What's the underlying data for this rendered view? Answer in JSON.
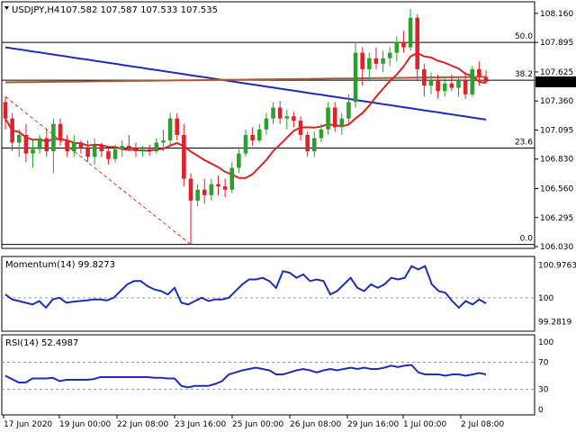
{
  "header": {
    "symbol_tf": "USDJPY,H4",
    "quotes": "107.582 107.587 107.533 107.535"
  },
  "price_panel": {
    "y_ticks": [
      "108.160",
      "107.895",
      "107.625",
      "107.360",
      "107.095",
      "106.830",
      "106.560",
      "106.295",
      "106.030"
    ],
    "current_price": "107.535",
    "fib_labels": [
      "50.0",
      "38.2",
      "23.6",
      "0.0"
    ]
  },
  "momentum_panel": {
    "title": "Momentum(14) 99.8273",
    "y_ticks": [
      "100.9763",
      "100",
      "99.2819"
    ]
  },
  "rsi_panel": {
    "title": "RSI(14) 52.4987",
    "y_ticks": [
      "100",
      "70",
      "30",
      "0"
    ]
  },
  "x_axis": {
    "labels": [
      "17 Jun 2020",
      "19 Jun 00:00",
      "22 Jun 08:00",
      "23 Jun 16:00",
      "25 Jun 00:00",
      "26 Jun 08:00",
      "29 Jun 16:00",
      "1 Jul 00:00",
      "2 Jul 08:00"
    ]
  },
  "colors": {
    "bull": "#2ca02c",
    "bear": "#e0202a",
    "sma_fast": "#dd2222",
    "sma_mid": "#1f2fb4",
    "sma_slow": "#a85a3a",
    "fib": "#e03030",
    "oscillator": "#1f2fb4"
  },
  "chart_data": [
    {
      "type": "candlestick",
      "title": "USDJPY,H4",
      "ylim": [
        106.03,
        108.2
      ],
      "x": [
        "17 Jun 2020",
        "19 Jun 00:00",
        "22 Jun 08:00",
        "23 Jun 16:00",
        "25 Jun 00:00",
        "26 Jun 08:00",
        "29 Jun 16:00",
        "1 Jul 00:00",
        "2 Jul 08:00"
      ],
      "ohlc": [
        [
          107.35,
          107.4,
          107.1,
          107.2
        ],
        [
          107.2,
          107.25,
          106.9,
          106.98
        ],
        [
          106.98,
          107.1,
          106.85,
          107.05
        ],
        [
          107.05,
          107.15,
          106.8,
          106.88
        ],
        [
          106.88,
          107.0,
          106.75,
          106.92
        ],
        [
          106.92,
          107.05,
          106.88,
          107.02
        ],
        [
          107.02,
          107.1,
          106.85,
          106.9
        ],
        [
          106.9,
          107.2,
          106.7,
          107.15
        ],
        [
          107.15,
          107.2,
          106.95,
          107.0
        ],
        [
          107.0,
          107.05,
          106.85,
          106.9
        ],
        [
          106.9,
          107.05,
          106.85,
          106.98
        ],
        [
          106.98,
          107.0,
          106.88,
          106.93
        ],
        [
          106.93,
          107.0,
          106.8,
          106.85
        ],
        [
          106.85,
          107.02,
          106.78,
          106.95
        ],
        [
          106.95,
          106.98,
          106.85,
          106.9
        ],
        [
          106.9,
          106.95,
          106.78,
          106.83
        ],
        [
          106.83,
          106.96,
          106.8,
          106.92
        ],
        [
          106.92,
          107.0,
          106.85,
          106.95
        ],
        [
          106.95,
          107.05,
          106.9,
          106.93
        ],
        [
          106.93,
          106.98,
          106.85,
          106.9
        ],
        [
          106.9,
          106.95,
          106.85,
          106.92
        ],
        [
          106.92,
          106.96,
          106.86,
          106.9
        ],
        [
          106.9,
          107.02,
          106.88,
          106.98
        ],
        [
          106.98,
          107.1,
          106.9,
          107.0
        ],
        [
          107.0,
          107.25,
          106.95,
          107.2
        ],
        [
          107.2,
          107.25,
          107.0,
          107.05
        ],
        [
          107.05,
          107.15,
          106.58,
          106.65
        ],
        [
          106.65,
          106.7,
          106.05,
          106.45
        ],
        [
          106.45,
          106.6,
          106.4,
          106.55
        ],
        [
          106.55,
          106.65,
          106.42,
          106.5
        ],
        [
          106.5,
          106.65,
          106.45,
          106.6
        ],
        [
          106.6,
          106.68,
          106.5,
          106.58
        ],
        [
          106.58,
          106.65,
          106.48,
          106.55
        ],
        [
          106.55,
          106.8,
          106.52,
          106.75
        ],
        [
          106.75,
          106.92,
          106.7,
          106.88
        ],
        [
          106.88,
          107.1,
          106.85,
          107.05
        ],
        [
          107.05,
          107.12,
          106.95,
          107.0
        ],
        [
          107.0,
          107.15,
          106.98,
          107.1
        ],
        [
          107.1,
          107.25,
          107.05,
          107.2
        ],
        [
          107.2,
          107.35,
          107.15,
          107.3
        ],
        [
          107.3,
          107.36,
          107.15,
          107.2
        ],
        [
          107.2,
          107.28,
          107.1,
          107.22
        ],
        [
          107.22,
          107.26,
          107.12,
          107.18
        ],
        [
          107.18,
          107.22,
          107.0,
          107.05
        ],
        [
          107.05,
          107.08,
          106.85,
          106.9
        ],
        [
          106.9,
          107.08,
          106.85,
          107.02
        ],
        [
          107.02,
          107.15,
          106.98,
          107.1
        ],
        [
          107.1,
          107.35,
          107.05,
          107.3
        ],
        [
          107.3,
          107.35,
          107.08,
          107.12
        ],
        [
          107.12,
          107.25,
          107.05,
          107.2
        ],
        [
          107.2,
          107.42,
          107.15,
          107.35
        ],
        [
          107.35,
          107.9,
          107.3,
          107.8
        ],
        [
          107.8,
          107.85,
          107.5,
          107.65
        ],
        [
          107.65,
          107.8,
          107.55,
          107.75
        ],
        [
          107.75,
          107.85,
          107.65,
          107.7
        ],
        [
          107.7,
          107.82,
          107.62,
          107.75
        ],
        [
          107.75,
          107.85,
          107.68,
          107.8
        ],
        [
          107.8,
          107.95,
          107.72,
          107.9
        ],
        [
          107.9,
          108.0,
          107.8,
          107.85
        ],
        [
          107.85,
          108.2,
          107.82,
          108.12
        ],
        [
          108.12,
          108.15,
          107.55,
          107.65
        ],
        [
          107.65,
          107.7,
          107.4,
          107.5
        ],
        [
          107.5,
          107.62,
          107.42,
          107.55
        ],
        [
          107.55,
          107.6,
          107.38,
          107.45
        ],
        [
          107.45,
          107.58,
          107.4,
          107.52
        ],
        [
          107.52,
          107.6,
          107.45,
          107.48
        ],
        [
          107.48,
          107.58,
          107.4,
          107.55
        ],
        [
          107.55,
          107.62,
          107.38,
          107.42
        ],
        [
          107.42,
          107.68,
          107.4,
          107.65
        ],
        [
          107.65,
          107.72,
          107.5,
          107.58
        ],
        [
          107.58,
          107.64,
          107.52,
          107.535
        ]
      ]
    },
    {
      "type": "line",
      "title": "Momentum(14) 99.8273",
      "ylim": [
        99.05,
        101.05
      ],
      "series": [
        {
          "values": [
            100.1,
            99.95,
            99.9,
            99.85,
            99.8,
            99.9,
            99.7,
            99.95,
            100.0,
            99.85,
            99.88,
            99.9,
            99.92,
            99.95,
            99.95,
            99.92,
            100.0,
            100.2,
            100.4,
            100.5,
            100.5,
            100.35,
            100.25,
            100.2,
            100.1,
            100.3,
            99.85,
            99.8,
            99.9,
            100.0,
            99.9,
            99.95,
            99.95,
            100.0,
            100.2,
            100.4,
            100.55,
            100.55,
            100.6,
            100.5,
            100.3,
            100.8,
            100.75,
            100.6,
            100.7,
            100.5,
            100.55,
            100.5,
            100.1,
            100.2,
            100.4,
            100.6,
            100.3,
            100.2,
            100.4,
            100.3,
            100.4,
            100.6,
            100.55,
            100.6,
            100.95,
            100.85,
            100.95,
            100.4,
            100.2,
            100.15,
            99.9,
            99.7,
            99.9,
            99.8,
            99.95,
            99.83
          ]
        }
      ]
    },
    {
      "type": "line",
      "title": "RSI(14) 52.4987",
      "ylim": [
        0,
        100
      ],
      "series": [
        {
          "values": [
            50,
            45,
            40,
            40,
            46,
            46,
            46,
            47,
            42,
            44,
            44,
            44,
            44,
            45,
            48,
            48,
            48,
            48,
            48,
            48,
            48,
            48,
            47,
            47,
            46,
            46,
            35,
            33,
            35,
            35,
            35,
            38,
            42,
            52,
            55,
            58,
            60,
            62,
            60,
            58,
            52,
            52,
            55,
            58,
            60,
            58,
            55,
            58,
            60,
            58,
            60,
            62,
            60,
            62,
            60,
            60,
            62,
            65,
            63,
            65,
            66,
            55,
            52,
            52,
            52,
            50,
            52,
            52,
            50,
            52,
            54,
            52
          ]
        }
      ]
    }
  ]
}
